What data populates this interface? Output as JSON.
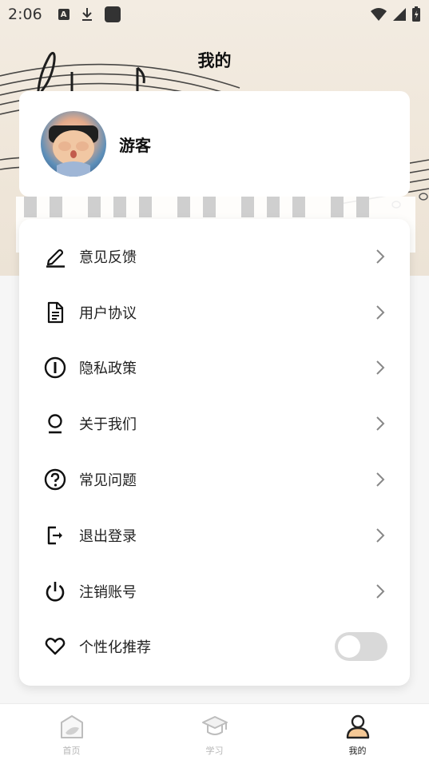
{
  "status_bar": {
    "time": "2:06",
    "a_icon_letter": "A",
    "left_icons": [
      "font-a-icon",
      "download-icon",
      "square-app-icon"
    ],
    "right_icons": [
      "wifi-icon",
      "cell-signal-icon",
      "battery-charging-icon"
    ]
  },
  "header": {
    "title": "我的"
  },
  "profile": {
    "username": "游客",
    "avatar_icon": "avatar"
  },
  "menu": {
    "items": [
      {
        "label": "意见反馈",
        "icon": "pencil-icon"
      },
      {
        "label": "用户协议",
        "icon": "document-icon"
      },
      {
        "label": "隐私政策",
        "icon": "info-circle-icon"
      },
      {
        "label": "关于我们",
        "icon": "person-icon"
      },
      {
        "label": "常见问题",
        "icon": "question-circle-icon"
      },
      {
        "label": "退出登录",
        "icon": "logout-icon"
      },
      {
        "label": "注销账号",
        "icon": "power-icon"
      }
    ],
    "toggle_item": {
      "label": "个性化推荐",
      "icon": "heart-icon",
      "enabled": false
    }
  },
  "bottom_nav": {
    "items": [
      {
        "label": "首页",
        "icon": "home-icon",
        "active": false
      },
      {
        "label": "学习",
        "icon": "graduation-cap-icon",
        "active": false
      },
      {
        "label": "我的",
        "icon": "profile-icon",
        "active": true
      }
    ]
  },
  "colors": {
    "header_bg": "#f3ece2",
    "card_bg": "#ffffff",
    "page_bg": "#f6f6f6",
    "toggle_off": "#d9d9d9",
    "nav_active": "#222222",
    "nav_inactive": "#b5b5b5"
  }
}
